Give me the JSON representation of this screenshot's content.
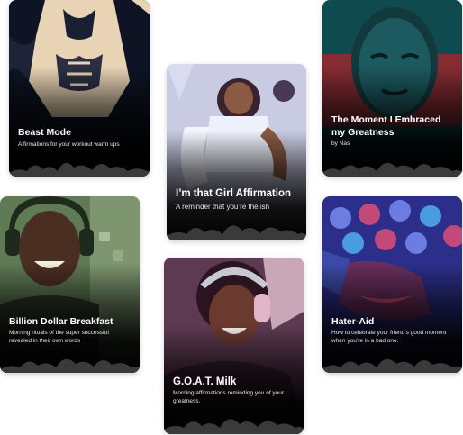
{
  "cards": [
    {
      "title": "Beast Mode",
      "subtitle": "Affirmations for your workout warm ups"
    },
    {
      "title": "I’m that Girl Affirmation",
      "subtitle": "A reminder that you’re the ish"
    },
    {
      "title": "The Moment I Embraced my Greatness",
      "subtitle": "by Nas"
    },
    {
      "title": "Billion Dollar Breakfast",
      "subtitle": "Morning rituals of the super successful revealed in their own words"
    },
    {
      "title": "G.O.A.T. Milk",
      "subtitle": "Morning affirmations reminding you of your greatness."
    },
    {
      "title": "Hater-Aid",
      "subtitle": "How to celebrate your friend’s good moment when you’re in a bad one."
    }
  ],
  "colors": {
    "beast_bg": "#0e1424",
    "girl_bg": "#c9cbe3",
    "nas_bg": "#0f4a4f",
    "billion_bg": "#5f7a55",
    "goat_bg": "#5e3a52",
    "hater_bg": "#2b2f8a",
    "text": "#ffffff"
  }
}
